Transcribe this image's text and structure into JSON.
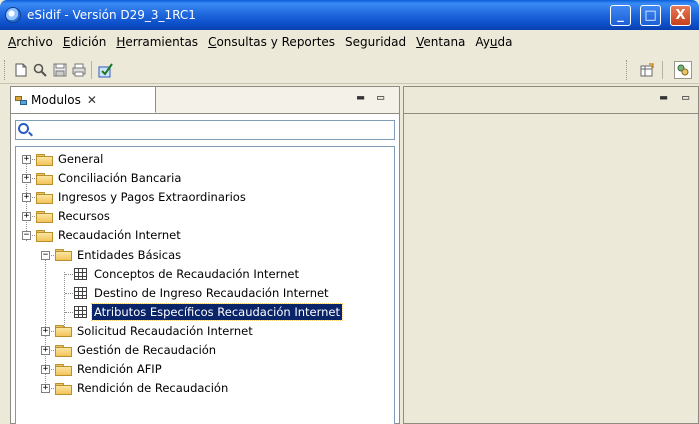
{
  "window": {
    "title": "eSidif - Versión D29_3_1RC1",
    "controls": {
      "minimize": "_",
      "maximize": "□",
      "close": "X"
    }
  },
  "menu": [
    {
      "label": "Archivo",
      "mnemonic_index": 0
    },
    {
      "label": "Edición",
      "mnemonic_index": 0
    },
    {
      "label": "Herramientas",
      "mnemonic_index": 0
    },
    {
      "label": "Consultas y Reportes",
      "mnemonic_index": 0
    },
    {
      "label": "Seguridad",
      "mnemonic_index": -1
    },
    {
      "label": "Ventana",
      "mnemonic_index": 0
    },
    {
      "label": "Ayuda",
      "mnemonic_index": 2
    }
  ],
  "panel": {
    "tab_label": "Modulos",
    "tab_close": "✕",
    "minimize": "▬",
    "maximize": "▭",
    "search_placeholder": ""
  },
  "tree": [
    {
      "label": "General",
      "level": 0,
      "expander": "+",
      "icon": "folder-icon"
    },
    {
      "label": "Conciliación Bancaria",
      "level": 0,
      "expander": "+",
      "icon": "folder-icon"
    },
    {
      "label": "Ingresos y Pagos Extraordinarios",
      "level": 0,
      "expander": "+",
      "icon": "folder-icon"
    },
    {
      "label": "Recursos",
      "level": 0,
      "expander": "+",
      "icon": "folder-icon"
    },
    {
      "label": "Recaudación Internet",
      "level": 0,
      "expander": "−",
      "icon": "folder-icon"
    },
    {
      "label": "Entidades Básicas",
      "level": 1,
      "expander": "−",
      "icon": "folder-icon"
    },
    {
      "label": "Conceptos de Recaudación Internet",
      "level": 2,
      "expander": "",
      "icon": "table-icon"
    },
    {
      "label": "Destino de Ingreso Recaudación Internet",
      "level": 2,
      "expander": "",
      "icon": "table-icon"
    },
    {
      "label": "Atributos Específicos Recaudación Internet",
      "level": 2,
      "expander": "",
      "icon": "table-icon",
      "selected": true
    },
    {
      "label": "Solicitud Recaudación Internet",
      "level": 1,
      "expander": "+",
      "icon": "folder-icon"
    },
    {
      "label": "Gestión de Recaudación",
      "level": 1,
      "expander": "+",
      "icon": "folder-icon"
    },
    {
      "label": "Rendición AFIP",
      "level": 1,
      "expander": "+",
      "icon": "folder-icon"
    },
    {
      "label": "Rendición de Recaudación",
      "level": 1,
      "expander": "+",
      "icon": "folder-icon"
    }
  ],
  "colors": {
    "titlebar": "#2169de",
    "selection": "#0a246a",
    "chrome": "#ece9d8"
  }
}
